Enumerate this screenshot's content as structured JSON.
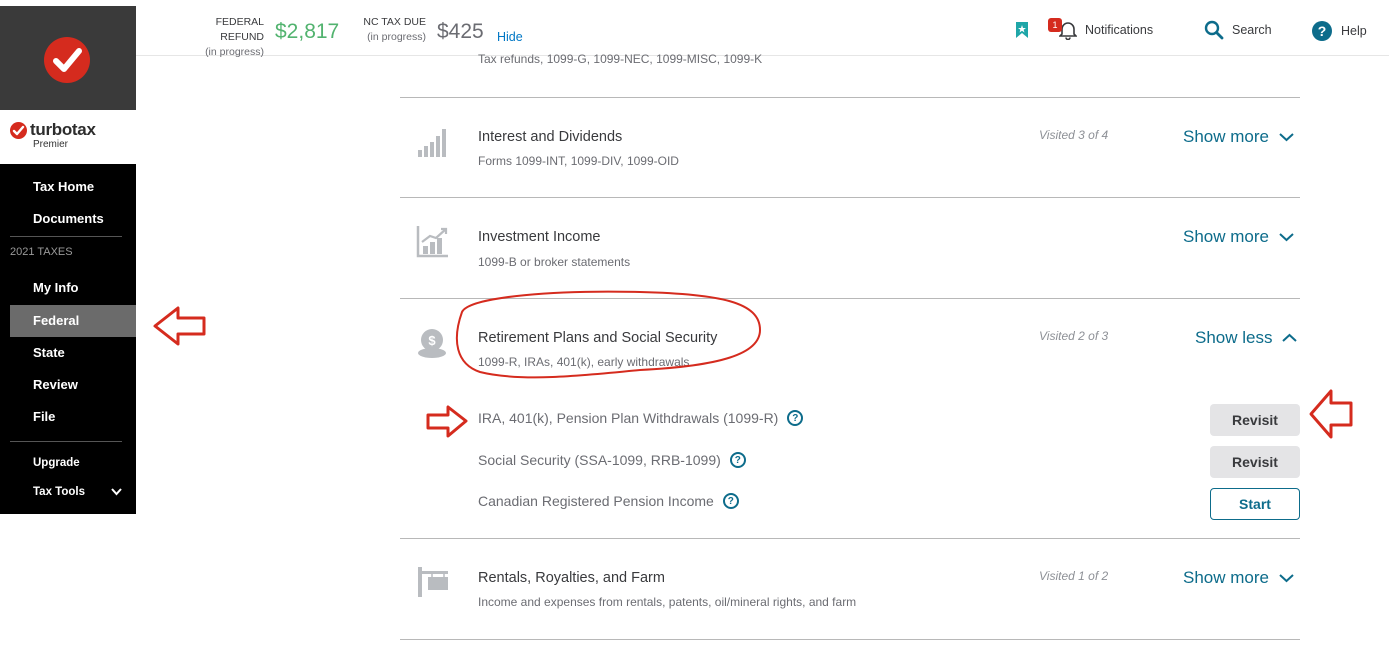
{
  "sidebar": {
    "brand_name": "turbotax",
    "edition": "Premier",
    "items": [
      {
        "label": "Tax Home"
      },
      {
        "label": "Documents"
      },
      {
        "label": "My Info"
      },
      {
        "label": "Federal"
      },
      {
        "label": "State"
      },
      {
        "label": "Review"
      },
      {
        "label": "File"
      },
      {
        "label": "Upgrade"
      },
      {
        "label": "Tax Tools"
      }
    ],
    "section_label": "2021 TAXES",
    "active_item": "Federal"
  },
  "header": {
    "federal_label": "FEDERAL REFUND",
    "federal_sub": "(in progress)",
    "federal_amount": "$2,817",
    "state_label": "NC TAX DUE",
    "state_sub": "(in progress)",
    "state_amount": "$425",
    "hide_label": "Hide",
    "notifications_label": "Notifications",
    "notifications_count": "1",
    "search_label": "Search",
    "help_label": "Help"
  },
  "colors": {
    "refund_green": "#52b36f",
    "accent_teal": "#0d6c8b",
    "annotation_red": "#d52b1e",
    "brand_red": "#d52b1e"
  },
  "main": {
    "top_partial_sub": "Tax refunds, 1099-G, 1099-NEC, 1099-MISC, 1099-K",
    "sections": [
      {
        "title": "Interest and Dividends",
        "sub": "Forms 1099-INT, 1099-DIV, 1099-OID",
        "visited": "Visited 3 of 4",
        "toggle": "Show more",
        "icon": "bar-chart-icon"
      },
      {
        "title": "Investment Income",
        "sub": "1099-B or broker statements",
        "visited": "",
        "toggle": "Show more",
        "icon": "growth-chart-icon"
      },
      {
        "title": "Retirement Plans and Social Security",
        "sub": "1099-R, IRAs, 401(k), early withdrawals",
        "visited": "Visited 2 of 3",
        "toggle": "Show less",
        "icon": "money-bag-icon"
      },
      {
        "title": "Rentals, Royalties, and Farm",
        "sub": "Income and expenses from rentals, patents, oil/mineral rights, and farm",
        "visited": "Visited 1 of 2",
        "toggle": "Show more",
        "icon": "sign-post-icon"
      }
    ],
    "retirement_items": [
      {
        "label": "IRA, 401(k), Pension Plan Withdrawals (1099-R)",
        "action": "Revisit"
      },
      {
        "label": "Social Security (SSA-1099, RRB-1099)",
        "action": "Revisit"
      },
      {
        "label": "Canadian Registered Pension Income",
        "action": "Start"
      }
    ]
  }
}
